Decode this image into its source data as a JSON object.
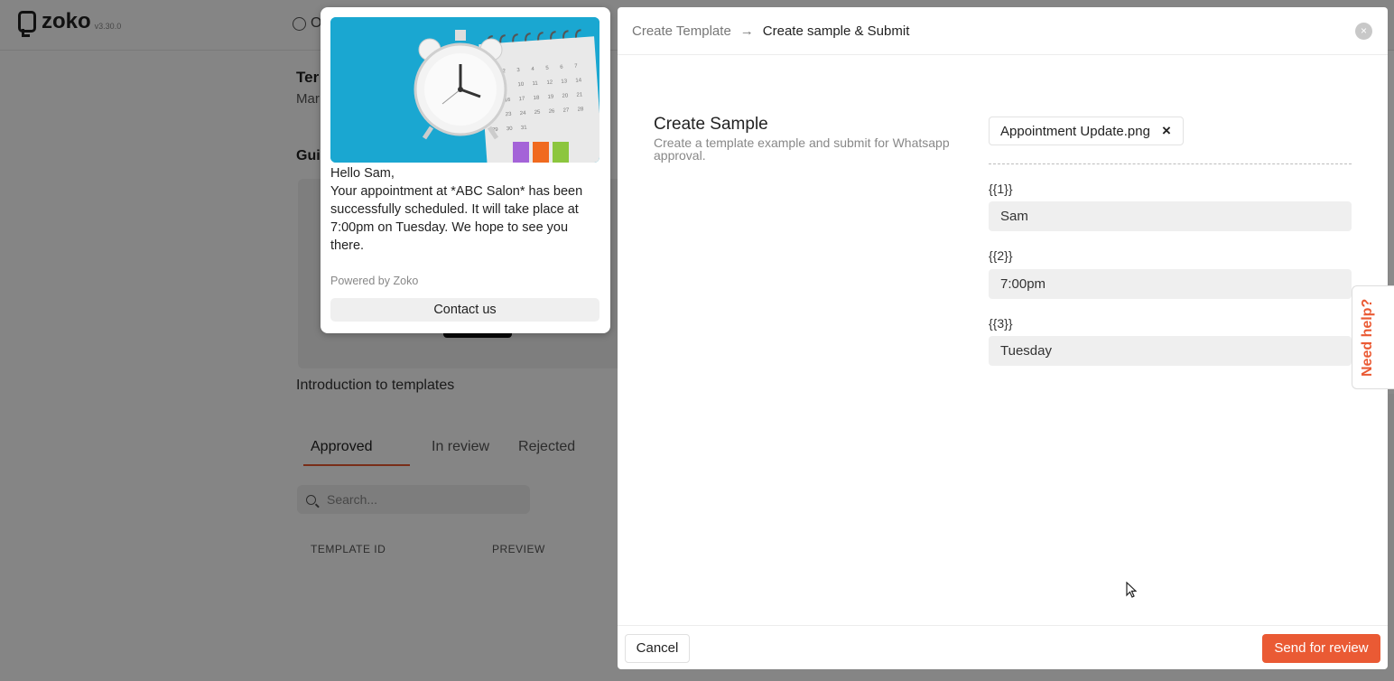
{
  "app": {
    "logo_text": "zoko",
    "version": "v3.30.0",
    "top_radio_label": "O",
    "colors": {
      "accent": "#ea5a34",
      "overlay": "rgba(0,0,0,0.48)"
    }
  },
  "background": {
    "page_title": "Ter",
    "page_subtitle": "Mar",
    "guide_heading": "Gui",
    "intro_text": "Introduction to templates",
    "tabs": [
      {
        "label": "Approved",
        "active": true
      },
      {
        "label": "In review",
        "active": false
      },
      {
        "label": "Rejected",
        "active": false
      }
    ],
    "search_placeholder": "Search...",
    "table_headers": [
      "TEMPLATE ID",
      "PREVIEW"
    ]
  },
  "preview": {
    "image_icon": "alarm-clock-calendar-image",
    "message": "Hello Sam,\nYour appointment at *ABC Salon* has been successfully scheduled. It will take place at 7:00pm on Tuesday. We hope to see you there.",
    "powered_by": "Powered by Zoko",
    "button_label": "Contact us"
  },
  "drawer": {
    "breadcrumb_prev": "Create Template",
    "breadcrumb_arrow": "→",
    "breadcrumb_current": "Create sample & Submit",
    "close_icon": "×",
    "section_title": "Create Sample",
    "section_desc": "Create a template example and submit for Whatsapp approval.",
    "file_name": "Appointment Update.png",
    "file_remove_icon": "×",
    "variables": [
      {
        "label": "{{1}}",
        "value": "Sam"
      },
      {
        "label": "{{2}}",
        "value": "7:00pm"
      },
      {
        "label": "{{3}}",
        "value": "Tuesday"
      }
    ],
    "cancel_label": "Cancel",
    "submit_label": "Send for review"
  },
  "help": {
    "label": "Need help?"
  }
}
